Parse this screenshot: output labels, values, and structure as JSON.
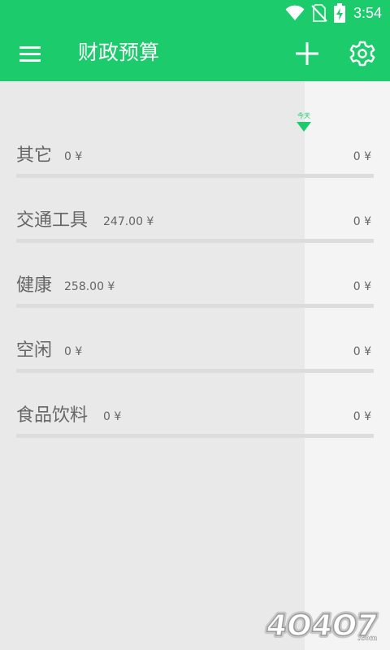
{
  "status_bar": {
    "time": "3:54",
    "icons": [
      "wifi-icon",
      "no-sim-icon",
      "battery-charging-icon"
    ]
  },
  "app_bar": {
    "title": "财政预算",
    "icons": [
      "menu-icon",
      "plus-icon",
      "gear-icon"
    ]
  },
  "timeline": {
    "today_label": "今天"
  },
  "colors": {
    "accent": "#1ccb6b",
    "elapsed_shade": "#e9e9e9",
    "background": "#f4f4f4",
    "bar_track": "#dcdcdc",
    "text": "#666666"
  },
  "categories": [
    {
      "name": "其它",
      "spent": "0 ¥",
      "budget": "0 ¥"
    },
    {
      "name": "交通工具",
      "spent": "247.00 ¥",
      "budget": "0 ¥"
    },
    {
      "name": "健康",
      "spent": "258.00 ¥",
      "budget": "0 ¥"
    },
    {
      "name": "空闲",
      "spent": "0 ¥",
      "budget": "0 ¥"
    },
    {
      "name": "食品饮料",
      "spent": "0 ¥",
      "budget": "0 ¥"
    }
  ],
  "watermark": {
    "text": "4O4O7.com"
  }
}
